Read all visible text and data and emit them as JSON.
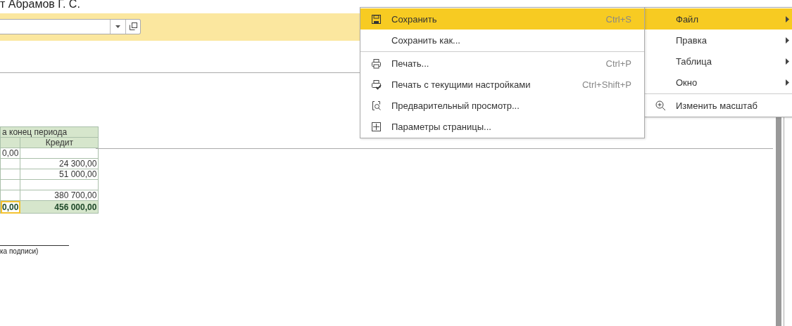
{
  "header": {
    "title": "т Абрамов Г. С."
  },
  "table": {
    "group_heading": "а конец периода",
    "columns": [
      "",
      "Кредит"
    ],
    "rows": [
      {
        "debit": "0,00",
        "credit": "",
        "total": false,
        "selected": false
      },
      {
        "debit": "",
        "credit": "24 300,00",
        "total": false,
        "selected": false
      },
      {
        "debit": "",
        "credit": "51 000,00",
        "total": false,
        "selected": false
      },
      {
        "debit": "",
        "credit": "",
        "total": false,
        "selected": false
      },
      {
        "debit": "",
        "credit": "380 700,00",
        "total": false,
        "selected": false
      },
      {
        "debit": "0,00",
        "credit": "456 000,00",
        "total": true,
        "selected": true
      }
    ]
  },
  "signature": {
    "caption": "ка подписи)"
  },
  "main_menu": {
    "items": [
      {
        "label": "Файл",
        "kind": "submenu",
        "selected": true
      },
      {
        "label": "Правка",
        "kind": "submenu",
        "selected": false
      },
      {
        "label": "Таблица",
        "kind": "submenu",
        "selected": false
      },
      {
        "label": "Окно",
        "kind": "submenu",
        "selected": false
      },
      {
        "label": "Изменить масштаб",
        "kind": "zoom",
        "selected": false,
        "separator_before": true
      }
    ]
  },
  "file_menu": {
    "items": [
      {
        "label": "Сохранить",
        "shortcut": "Ctrl+S",
        "selected": true
      },
      {
        "label": "Сохранить как...",
        "selected": false
      },
      {
        "label": "Печать...",
        "shortcut": "Ctrl+P",
        "selected": false,
        "separator_before": true
      },
      {
        "label": "Печать с текущими настройками",
        "shortcut": "Ctrl+Shift+P",
        "selected": false
      },
      {
        "label": "Предварительный просмотр...",
        "selected": false
      },
      {
        "label": "Параметры страницы...",
        "selected": false
      }
    ]
  }
}
